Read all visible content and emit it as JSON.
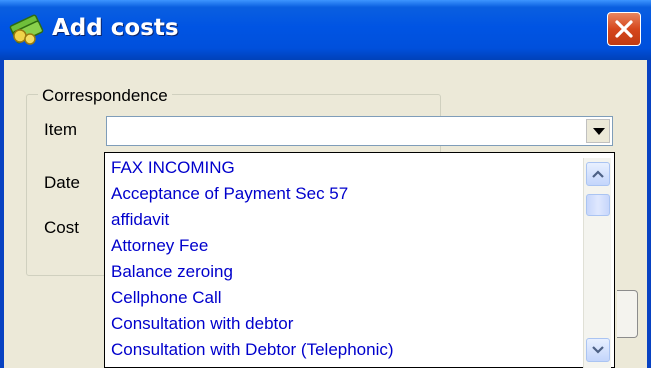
{
  "window": {
    "title": "Add costs"
  },
  "group": {
    "legend": "Correspondence",
    "item_label": "Item",
    "date_label": "Date",
    "cost_label": "Cost"
  },
  "item_combo": {
    "value": ""
  },
  "dropdown": {
    "items": [
      " FAX INCOMING",
      "Acceptance of Payment Sec 57",
      "affidavit",
      "Attorney Fee",
      "Balance zeroing",
      "Cellphone Call",
      "Consultation with debtor",
      "Consultation with Debtor (Telephonic)"
    ]
  },
  "colors": {
    "titlebar": "#0054e3",
    "close_button": "#d6471d",
    "dropdown_text": "#0000cc",
    "window_bg": "#ece9d8"
  },
  "icons": {
    "app": "coins-app-icon",
    "close": "close-icon",
    "combo_arrow": "chevron-down-icon",
    "scroll_up": "chevron-up-icon",
    "scroll_down": "chevron-down-icon"
  }
}
